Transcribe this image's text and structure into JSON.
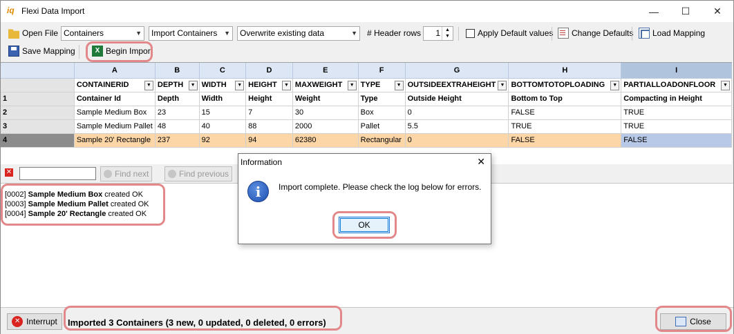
{
  "window": {
    "title": "Flexi Data Import",
    "icon": "iq-logo-icon"
  },
  "toolbar": {
    "open_file": "Open File",
    "entity_select": "Containers",
    "template_select": "Import Containers",
    "mode_select": "Overwrite existing data",
    "header_rows_label": "# Header rows",
    "header_rows_value": "1",
    "apply_defaults_label": "Apply Default values",
    "change_defaults": "Change Defaults",
    "load_mapping": "Load Mapping",
    "save_mapping": "Save Mapping",
    "begin_import": "Begin Import"
  },
  "grid": {
    "columns": [
      "A",
      "B",
      "C",
      "D",
      "E",
      "F",
      "G",
      "H",
      "I"
    ],
    "fields": [
      "CONTAINERID",
      "DEPTH",
      "WIDTH",
      "HEIGHT",
      "MAXWEIGHT",
      "TYPE",
      "OUTSIDEEXTRAHEIGHT",
      "BOTTOMTOTOPLOADING",
      "PARTIALLOADONFLOOR"
    ],
    "rows": [
      {
        "num": "1",
        "cells": [
          "Container Id",
          "Depth",
          "Width",
          "Height",
          "Weight",
          "Type",
          "Outside Height",
          "Bottom to Top",
          "Compacting in Height"
        ]
      },
      {
        "num": "2",
        "cells": [
          "Sample Medium Box",
          "23",
          "15",
          "7",
          "30",
          "Box",
          "0",
          "FALSE",
          "TRUE"
        ]
      },
      {
        "num": "3",
        "cells": [
          "Sample Medium Pallet",
          "48",
          "40",
          "88",
          "2000",
          "Pallet",
          "5.5",
          "TRUE",
          "TRUE"
        ]
      },
      {
        "num": "4",
        "cells": [
          "Sample 20' Rectangle",
          "237",
          "92",
          "94",
          "62380",
          "Rectangular",
          "0",
          "FALSE",
          "FALSE"
        ]
      }
    ]
  },
  "find": {
    "next": "Find next",
    "previous": "Find previous"
  },
  "log": [
    {
      "id": "[0002]",
      "name": "Sample Medium Box",
      "suffix": "created OK"
    },
    {
      "id": "[0003]",
      "name": "Sample Medium Pallet",
      "suffix": "created OK"
    },
    {
      "id": "[0004]",
      "name": "Sample 20' Rectangle",
      "suffix": "created OK"
    }
  ],
  "status": {
    "interrupt": "Interrupt",
    "message": "Imported 3 Containers (3 new, 0 updated, 0 deleted, 0 errors)",
    "close": "Close"
  },
  "dialog": {
    "title": "Information",
    "message": "Import complete. Please check the log below for errors.",
    "ok": "OK",
    "icon": "info-icon"
  }
}
